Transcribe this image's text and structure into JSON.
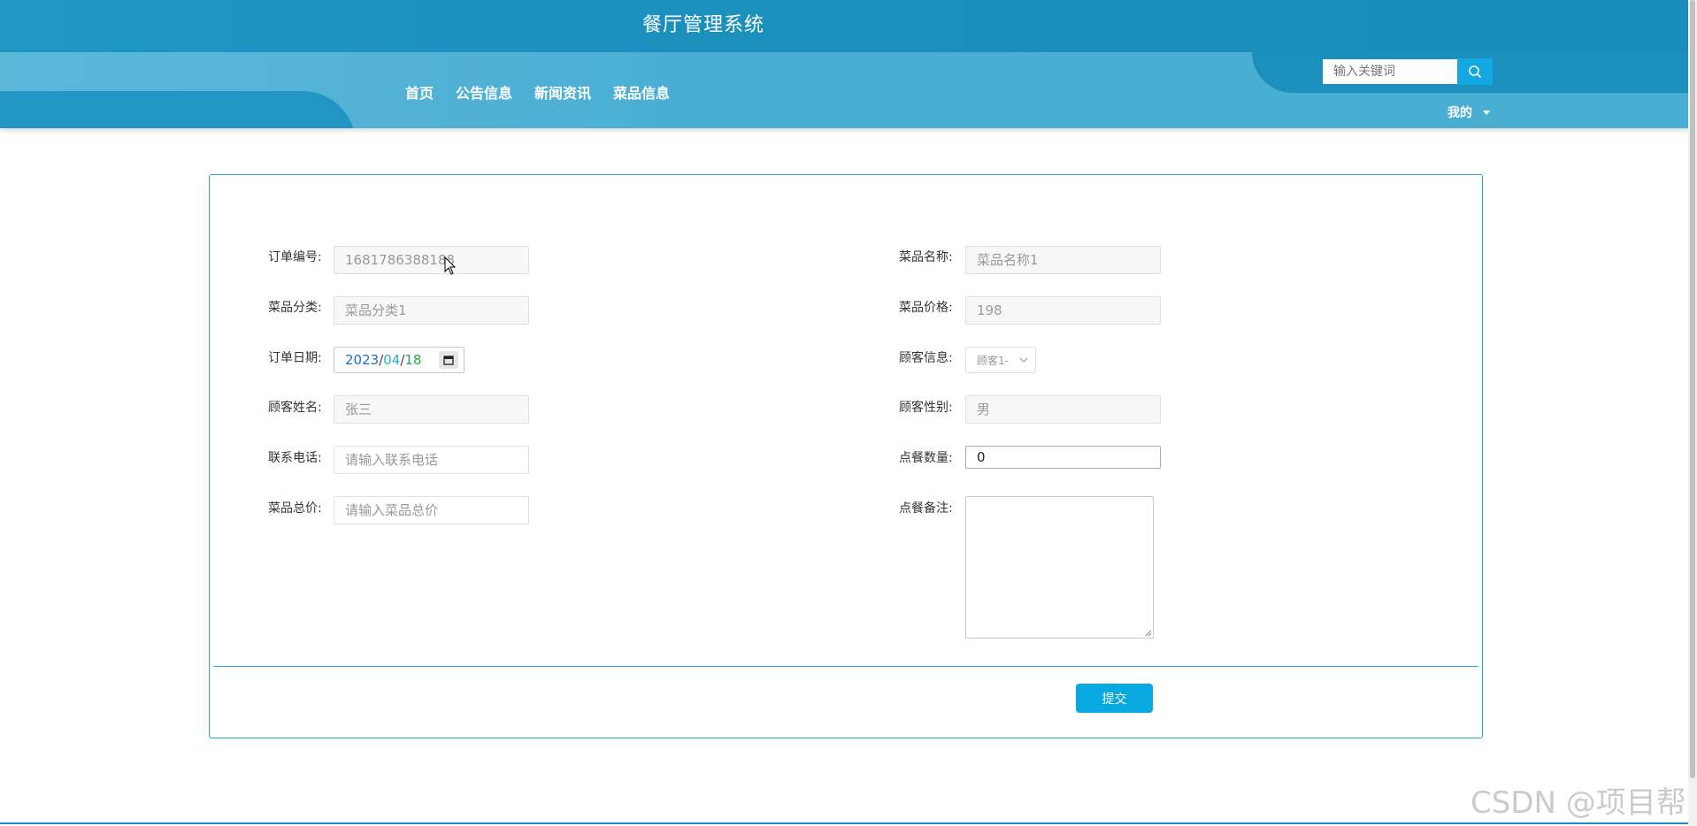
{
  "header": {
    "title": "餐厅管理系统",
    "nav": [
      "首页",
      "公告信息",
      "新闻资讯",
      "菜品信息"
    ],
    "search_placeholder": "输入关键词",
    "user_menu": "我的"
  },
  "form": {
    "order_no": {
      "label": "订单编号:",
      "value": "1681786388188"
    },
    "dish_name": {
      "label": "菜品名称:",
      "value": "菜品名称1"
    },
    "dish_category": {
      "label": "菜品分类:",
      "value": "菜品分类1"
    },
    "dish_price": {
      "label": "菜品价格:",
      "value": "198"
    },
    "order_date": {
      "label": "订单日期:",
      "year": "2023",
      "month": "04",
      "day": "18",
      "sep": "/"
    },
    "customer_info": {
      "label": "顾客信息:",
      "value": "顾客1-"
    },
    "customer_name": {
      "label": "顾客姓名:",
      "value": "张三"
    },
    "customer_gender": {
      "label": "顾客性别:",
      "value": "男"
    },
    "phone": {
      "label": "联系电话:",
      "placeholder": "请输入联系电话"
    },
    "quantity": {
      "label": "点餐数量:",
      "value": "0"
    },
    "total_price": {
      "label": "菜品总价:",
      "placeholder": "请输入菜品总价"
    },
    "remark": {
      "label": "点餐备注:"
    },
    "submit_label": "提交"
  },
  "watermark": "CSDN @项目帮",
  "colors": {
    "header": "#1a8fbb",
    "accent": "#07a9e0",
    "border": "#27a9d9"
  }
}
